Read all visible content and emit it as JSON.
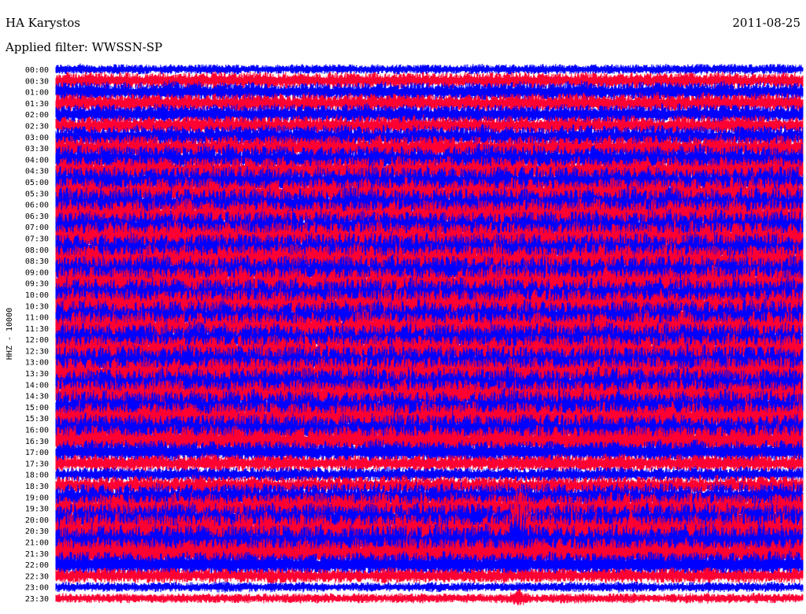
{
  "header": {
    "station": "HA Karystos",
    "date": "2011-08-25",
    "filter": "Applied filter: WWSSN-SP"
  },
  "chart_data": {
    "type": "line",
    "title": "HA Karystos",
    "subtitle": "Applied filter: WWSSN-SP",
    "ylabel": "HHZ - 10000",
    "xlabel": "",
    "row_minutes": 30,
    "row_labels": [
      "00:00",
      "00:30",
      "01:00",
      "01:30",
      "02:00",
      "02:30",
      "03:00",
      "03:30",
      "04:00",
      "04:30",
      "05:00",
      "05:30",
      "06:00",
      "06:30",
      "07:00",
      "07:30",
      "08:00",
      "08:30",
      "09:00",
      "09:30",
      "10:00",
      "10:30",
      "11:00",
      "11:30",
      "12:00",
      "12:30",
      "13:00",
      "13:30",
      "14:00",
      "14:30",
      "15:00",
      "15:30",
      "16:00",
      "16:30",
      "17:00",
      "17:30",
      "18:00",
      "18:30",
      "19:00",
      "19:30",
      "20:00",
      "20:30",
      "21:00",
      "21:30",
      "22:00",
      "22:30",
      "23:00",
      "23:30"
    ],
    "relative_amplitude": [
      0.4,
      0.7,
      0.8,
      0.8,
      0.8,
      0.8,
      0.9,
      1.0,
      1.1,
      1.1,
      1.2,
      1.2,
      1.3,
      1.3,
      1.3,
      1.3,
      1.3,
      1.3,
      1.3,
      1.3,
      1.3,
      1.3,
      1.3,
      1.3,
      1.3,
      1.3,
      1.3,
      1.3,
      1.3,
      1.3,
      1.3,
      1.3,
      1.2,
      1.2,
      0.9,
      0.7,
      0.6,
      0.8,
      1.1,
      1.2,
      1.3,
      1.4,
      1.4,
      1.2,
      1.0,
      0.6,
      0.4,
      0.4
    ],
    "events": [
      {
        "row_label": "20:30",
        "minute": 18.6,
        "note": ""
      },
      {
        "row_label": "21:00",
        "minute": 18.6,
        "note": ""
      },
      {
        "row_label": "23:30",
        "minute": 18.6,
        "note": ""
      }
    ],
    "colors": [
      "#0000ff",
      "#ff0033"
    ]
  }
}
